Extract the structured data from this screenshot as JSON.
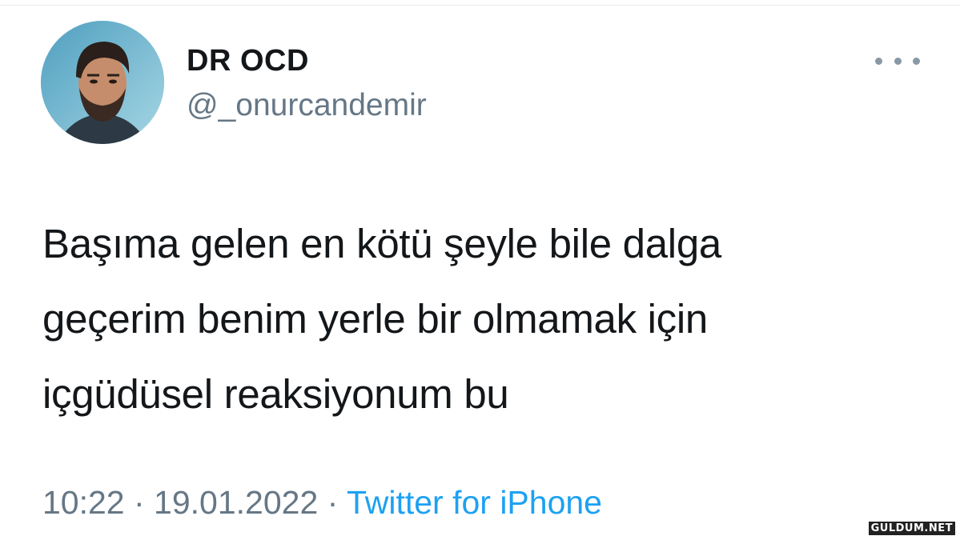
{
  "user": {
    "display_name": "DR OCD",
    "handle": "@_onurcandemir"
  },
  "tweet": {
    "text": "Başıma gelen en kötü şeyle bile dalga\ngeçerim benim yerle bir olmamak için\niçgüdüsel reaksiyonum bu",
    "time": "10:22",
    "separator": " · ",
    "date": "19.01.2022",
    "source": "Twitter for iPhone"
  },
  "icons": {
    "more": "more-horizontal-icon"
  },
  "colors": {
    "text": "#14171a",
    "secondary": "#657786",
    "link": "#1da1f2"
  },
  "watermark": "GULDUM.NET"
}
